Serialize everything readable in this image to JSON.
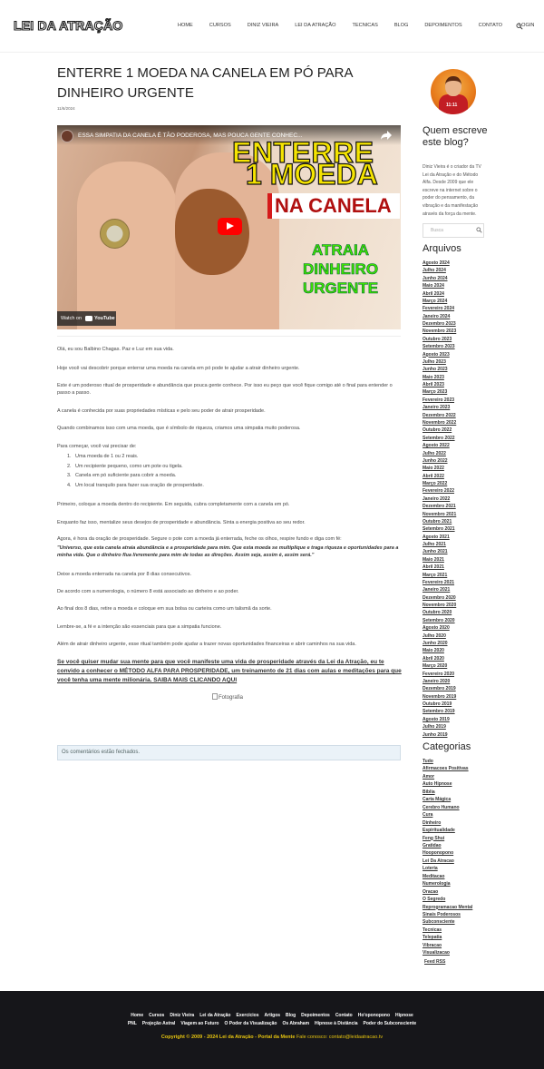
{
  "header": {
    "logo": "LEI DA ATRAÇÃO",
    "nav": [
      "HOME",
      "CURSOS",
      "DINIZ VIEIRA",
      "LEI DA ATRAÇÃO",
      "TECNICAS",
      "BLOG",
      "DEPOIMENTOS",
      "CONTATO",
      "LOGIN"
    ],
    "search_icon": "search-icon"
  },
  "post": {
    "title": "ENTERRE 1 MOEDA NA CANELA EM PÓ PARA DINHEIRO URGENTE",
    "date": "11/6/2024",
    "video": {
      "caption": "ESSA SIMPATIA DA CANELA É TÃO PODEROSA, MAS POUCA GENTE CONHEC...",
      "banner_line1": "ENTERRE",
      "banner_line2": "1 MOEDA",
      "banner_line3": "NA CANELA",
      "green_lines": [
        "ATRAIA",
        "DINHEIRO",
        "URGENTE"
      ],
      "watch_on": "Watch on",
      "youtube": "YouTube"
    },
    "paragraphs": [
      "Olá, eu sou Balbino Chagas. Paz e Luz em sua vida.",
      "Hoje você vai descobrir porque enterrar uma moeda na canela em pó pode te ajudar a atrair dinheiro urgente.",
      "Este é um poderoso ritual de prosperidade e abundância que pouca gente conhece. Por isso eu peço que você fique comigo até o final para entender o passo a passo.",
      "A canela é conhecida por suas propriedades místicas e pelo seu poder de atrair prosperidade.",
      "Quando combinamos isso com uma moeda, que é símbolo de riqueza, criamos uma simpatia muito poderosa.",
      "Para começar, você vai precisar de:"
    ],
    "list": [
      "Uma moeda de 1 ou 2 reais.",
      "Um recipiente pequeno, como um pote ou tigela.",
      "Canela em pó suficiente para cobrir a moeda.",
      "Um local tranquilo para fazer sua oração de prosperidade."
    ],
    "paragraphs2": [
      "Primeiro, coloque a moeda dentro do recipiente. Em seguida, cubra completamente com a canela em pó.",
      "Enquanto faz isso, mentalize seus desejos de prosperidade e abundância. Sinta a energia positiva ao seu redor."
    ],
    "prayer_intro": "Agora, é hora da oração de prosperidade. Segure o pote com a moeda já enterrada, feche os olhos, respire fundo e diga com fé:",
    "prayer": "\"Universo, que esta canela atraia abundância e a prosperidade para mim. Que esta moeda se multiplique e traga riqueza e oportunidades para a minha vida. Que o dinheiro flua livremente para mim de todas as direções. Assim seja, assim é, assim será.\"",
    "paragraphs3": [
      "Deixe a moeda enterrada na canela por 8 dias consecutivos.",
      "De acordo com a numerologia, o número 8 está associado ao dinheiro e ao poder.",
      "Ao final dos 8 dias, retire a moeda e coloque em sua bolsa ou carteira como um talismã da sorte.",
      "Lembre-se, a fé e a intenção são essenciais para que a simpatia funcione.",
      "Além de atrair dinheiro urgente, esse ritual também pode ajudar a trazer novas oportunidades financeiras e abrir caminhos na sua vida."
    ],
    "cta": "Se você quiser mudar sua mente para que você manifeste uma vida de prosperidade através da Lei da Atração, eu te convido a conhecer o MÉTODO ALFA PARA PROSPERIDADE, um treinamento de 21 dias com aulas e meditações para que você tenha uma mente milionária. SAIBA MAIS CLICANDO AQUI",
    "image_alt": "Fotografia",
    "comments_closed": "Os comentários estão fechados."
  },
  "sidebar": {
    "who_title": "Quem escreve este blog?",
    "who_text": "Diniz Vieira é o criador da TV Lei da Atração e do Método Alfa. Desde 2009 que ele escreve na internet sobre o poder do pensamento, da vibração e da manifestação através da força da mente.",
    "avatar_text": "11:11",
    "search_placeholder": "Busca",
    "archives_title": "Arquivos",
    "archives": [
      "Agosto 2024",
      "Julho 2024",
      "Junho 2024",
      "Maio 2024",
      "Abril 2024",
      "Março 2024",
      "Fevereiro 2024",
      "Janeiro 2024",
      "Dezembro 2023",
      "Novembro 2023",
      "Outubro 2023",
      "Setembro 2023",
      "Agosto 2023",
      "Julho 2023",
      "Junho 2023",
      "Maio 2023",
      "Abril 2023",
      "Março 2023",
      "Fevereiro 2023",
      "Janeiro 2023",
      "Dezembro 2022",
      "Novembro 2022",
      "Outubro 2022",
      "Setembro 2022",
      "Agosto 2022",
      "Julho 2022",
      "Junho 2022",
      "Maio 2022",
      "Abril 2022",
      "Março 2022",
      "Fevereiro 2022",
      "Janeiro 2022",
      "Dezembro 2021",
      "Novembro 2021",
      "Outubro 2021",
      "Setembro 2021",
      "Agosto 2021",
      "Julho 2021",
      "Junho 2021",
      "Maio 2021",
      "Abril 2021",
      "Março 2021",
      "Fevereiro 2021",
      "Janeiro 2021",
      "Dezembro 2020",
      "Novembro 2020",
      "Outubro 2020",
      "Setembro 2020",
      "Agosto 2020",
      "Julho 2020",
      "Junho 2020",
      "Maio 2020",
      "Abril 2020",
      "Março 2020",
      "Fevereiro 2020",
      "Janeiro 2020",
      "Dezembro 2019",
      "Novembro 2019",
      "Outubro 2019",
      "Setembro 2019",
      "Agosto 2019",
      "Julho 2019",
      "Junho 2019"
    ],
    "categories_title": "Categorias",
    "categories": [
      "Tudo",
      "Afirmacoes Positivas",
      "Amor",
      "Auto Hipnose",
      "Bíblia",
      "Carta Mágica",
      "Cerebro Humano",
      "Cura",
      "Dinheiro",
      "Espiritualidade",
      "Feng Shui",
      "Gratidao",
      "Hooponopono",
      "Lei Da Atracao",
      "Loteria",
      "Meditacao",
      "Numerologia",
      "Oracao",
      "O Segredo",
      "Reprogramacao Mental",
      "Sinais Poderosos",
      "Subconsciente",
      "Tecnicas",
      "Telepatia",
      "Vibracao",
      "Visualizacao"
    ],
    "feed": "Feed RSS"
  },
  "footer": {
    "row1": [
      "Home",
      "Cursos",
      "Diniz Vieira",
      "Lei da Atração",
      "Exercícios",
      "Artigos",
      "Blog",
      "Depoimentos",
      "Contato",
      "Ho'oponopono",
      "Hipnose"
    ],
    "row2": [
      "PNL",
      "Projeção Astral",
      "Viagem ao Futuro",
      "O Poder da Visualização",
      "Os Abraham",
      "Hipnose à Distância",
      "Poder do Subconsciente"
    ],
    "copyright": "Copyright © 2009 - 2024 Lei da Atração - Portal da Mente",
    "contact": "Fale conosco: contato@leidaatracao.tv"
  }
}
